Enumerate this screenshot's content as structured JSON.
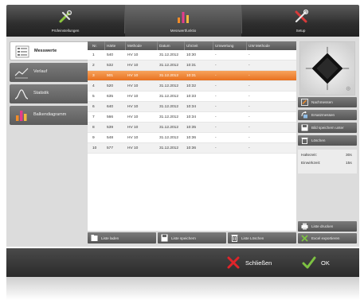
{
  "topbar": {
    "tabs": [
      {
        "label": "Prüfeinstellungen",
        "icon": "wrench-pencil-icon"
      },
      {
        "label": "Messwertfunktio",
        "icon": "bar-chart-icon"
      },
      {
        "label": "Setup",
        "icon": "tools-icon"
      }
    ]
  },
  "nav": {
    "items": [
      {
        "label": "Messwerte",
        "icon": "list-icon"
      },
      {
        "label": "Verlauf",
        "icon": "line-chart-icon"
      },
      {
        "label": "Statistik",
        "icon": "bell-curve-icon"
      },
      {
        "label": "Balkendiagramm",
        "icon": "bar-chart-icon"
      }
    ]
  },
  "table": {
    "headers": [
      "Nr.",
      "Härte",
      "Methode",
      "Datum",
      "Uhrzeit",
      "Umwertung",
      "UW Methode"
    ],
    "rows": [
      [
        "1",
        "540",
        "HV 10",
        "31.12.2012",
        "10:30",
        "-",
        "-"
      ],
      [
        "2",
        "532",
        "HV 10",
        "31.12.2012",
        "10:31",
        "-",
        "-"
      ],
      [
        "3",
        "501",
        "HV 10",
        "31.12.2012",
        "10:31",
        "-",
        "-"
      ],
      [
        "4",
        "520",
        "HV 10",
        "31.12.2012",
        "10:32",
        "-",
        "-"
      ],
      [
        "5",
        "635",
        "HV 10",
        "31.12.2012",
        "10:33",
        "-",
        "-"
      ],
      [
        "6",
        "640",
        "HV 10",
        "31.12.2012",
        "10:34",
        "-",
        "-"
      ],
      [
        "7",
        "566",
        "HV 10",
        "31.12.2012",
        "10:34",
        "-",
        "-"
      ],
      [
        "8",
        "539",
        "HV 10",
        "31.12.2012",
        "10:35",
        "-",
        "-"
      ],
      [
        "9",
        "548",
        "HV 10",
        "31.12.2012",
        "10:36",
        "-",
        "-"
      ],
      [
        "10",
        "577",
        "HV 10",
        "31.12.2012",
        "10:36",
        "-",
        "-"
      ]
    ],
    "selected_row": 3
  },
  "table_buttons": {
    "load": "Liste laden",
    "save": "Liste speichern",
    "delete": "Liste Löschen"
  },
  "right_panel": {
    "buttons": {
      "remeasure": "Nachmessen",
      "replace": "Ersatzmessen",
      "save_image": "Bild speichern unter",
      "delete": "Löschen",
      "print": "Liste drucken",
      "excel": "Excel exportieren"
    },
    "info": {
      "hold_label": "Haltezeit:",
      "hold_value": "30s",
      "penetration_label": "Einwirkzeit:",
      "penetration_value": "15s"
    }
  },
  "footer": {
    "close_label": "Schließen",
    "ok_label": "OK"
  },
  "colors": {
    "accent": "#e8711f",
    "close_red": "#e0242a",
    "ok_green": "#7dc242"
  }
}
